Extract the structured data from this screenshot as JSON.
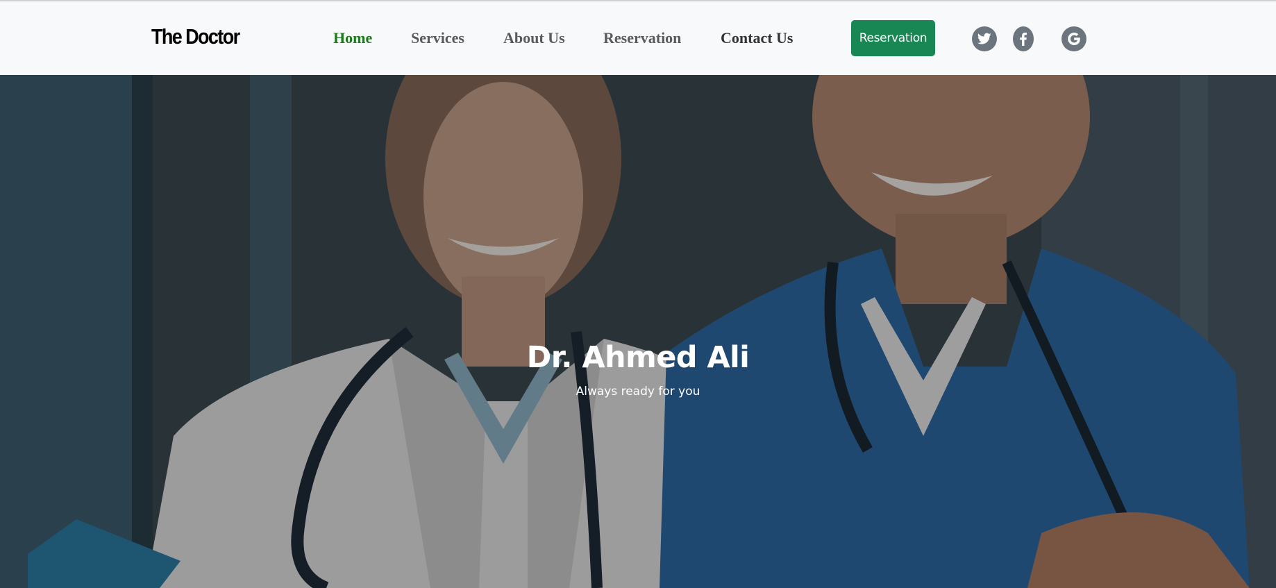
{
  "navbar": {
    "brand": "The Doctor",
    "links": [
      {
        "label": "Home",
        "active": true
      },
      {
        "label": "Services",
        "active": false
      },
      {
        "label": "About Us",
        "active": false
      },
      {
        "label": "Reservation",
        "active": false
      },
      {
        "label": "Contact Us",
        "active": false
      }
    ],
    "reservation_button": "Reservation",
    "social_icons": [
      "twitter-icon",
      "facebook-icon",
      "google-icon"
    ]
  },
  "hero": {
    "title": "Dr. Ahmed Ali",
    "subtitle": "Always ready for you"
  },
  "colors": {
    "navbar_bg": "#f8f9fa",
    "active_link": "#1e7a1e",
    "link": "#5a5a5a",
    "button": "#198754",
    "social": "#6c757d"
  }
}
